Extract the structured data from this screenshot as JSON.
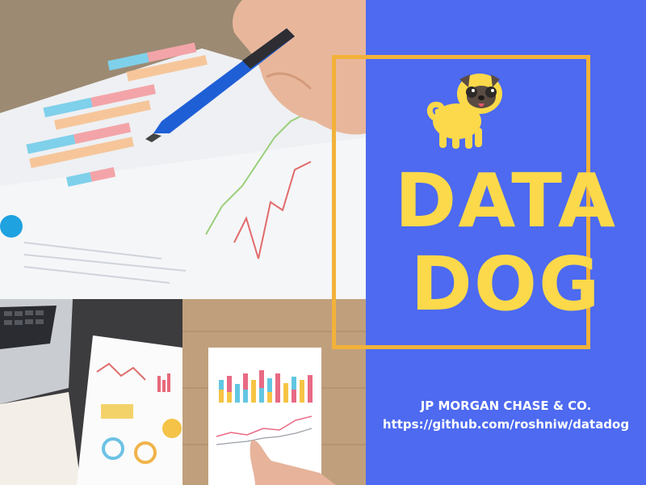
{
  "poster": {
    "title_line1": "DATA",
    "title_line2": "DOG",
    "organization": "JP MORGAN CHASE & CO.",
    "repo_url": "https://github.com/roshniw/datadog"
  },
  "mascot": {
    "icon": "pug-dog-icon"
  },
  "colors": {
    "panel_background": "#4d6af0",
    "frame_border": "#f2b23a",
    "title_text": "#fbd94a",
    "caption_text": "#ffffff"
  }
}
